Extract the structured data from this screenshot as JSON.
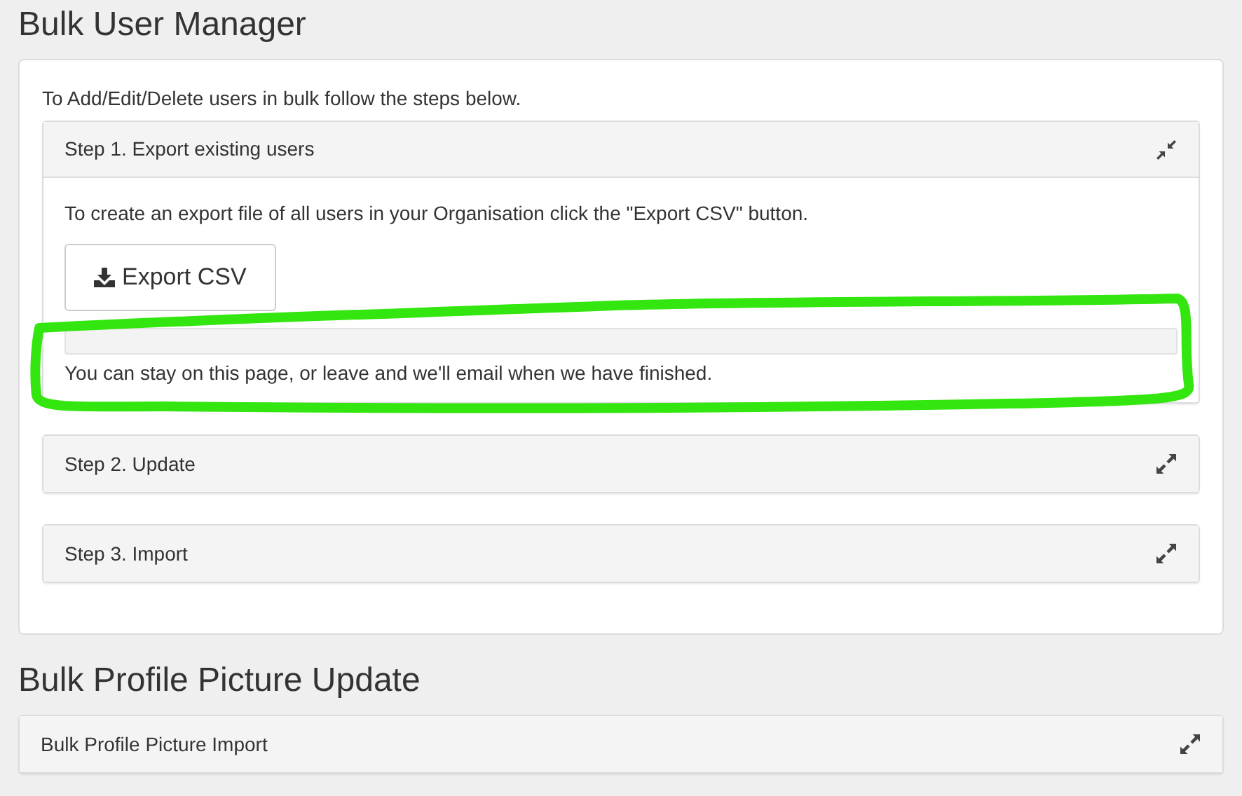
{
  "sections": [
    {
      "title": "Bulk User Manager",
      "intro": "To Add/Edit/Delete users in bulk follow the steps below.",
      "panels": [
        {
          "title": "Step 1. Export existing users",
          "expanded": true,
          "body": {
            "text": "To create an export file of all users in your Organisation click the \"Export CSV\" button.",
            "button": "Export CSV",
            "progress": {
              "level": 0
            },
            "note": "You can stay on this page, or leave and we'll email when we have finished."
          }
        },
        {
          "title": "Step 2. Update",
          "expanded": false
        },
        {
          "title": "Step 3. Import",
          "expanded": false
        }
      ]
    },
    {
      "title": "Bulk Profile Picture Update",
      "panels": [
        {
          "title": "Bulk Profile Picture Import",
          "expanded": false
        }
      ]
    }
  ],
  "annotations": [
    {
      "kind": "loop",
      "color": "#33e60f"
    }
  ]
}
